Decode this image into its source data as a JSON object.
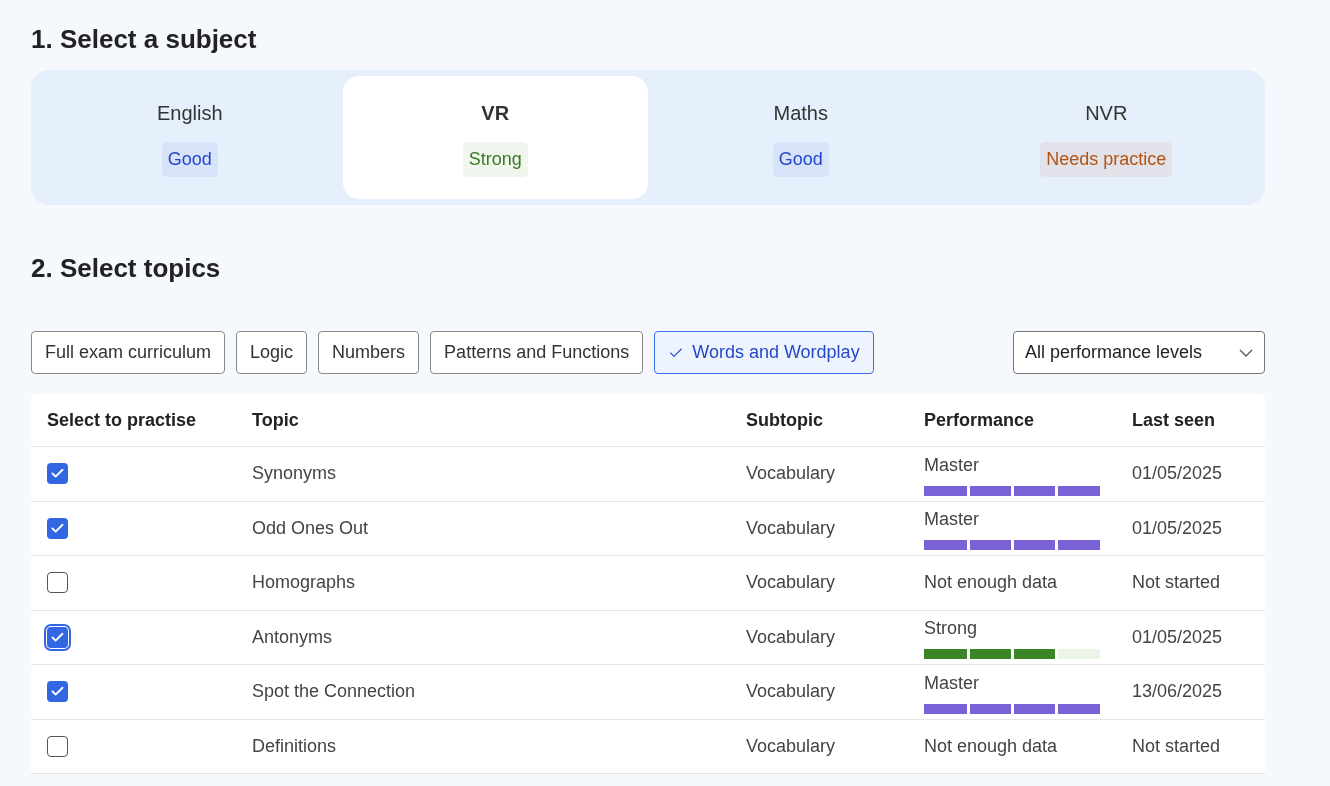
{
  "subject_section": {
    "heading": "1. Select a subject"
  },
  "subjects": [
    {
      "name": "English",
      "badge": "Good",
      "color": "#2447c9",
      "selected": false
    },
    {
      "name": "VR",
      "badge": "Strong",
      "color": "#3a7a22",
      "selected": true
    },
    {
      "name": "Maths",
      "badge": "Good",
      "color": "#2447c9",
      "selected": false
    },
    {
      "name": "NVR",
      "badge": "Needs practice",
      "color": "#b4520f",
      "selected": false
    }
  ],
  "topics_section": {
    "heading": "2. Select topics"
  },
  "filters": [
    {
      "label": "Full exam curriculum",
      "selected": false
    },
    {
      "label": "Logic",
      "selected": false
    },
    {
      "label": "Numbers",
      "selected": false
    },
    {
      "label": "Patterns and Functions",
      "selected": false
    },
    {
      "label": "Words and Wordplay",
      "selected": true
    }
  ],
  "performance_filter": {
    "value": "All performance levels"
  },
  "table": {
    "columns": [
      "Select to practise",
      "Topic",
      "Subtopic",
      "Performance",
      "Last seen"
    ],
    "rows": [
      {
        "checked": true,
        "focused": false,
        "topic": "Synonyms",
        "subtopic": "Vocabulary",
        "performance": {
          "kind": "bars",
          "label": "Master",
          "level": 1,
          "color": "#7b61d6"
        },
        "last_seen": "01/05/2025"
      },
      {
        "checked": true,
        "focused": false,
        "topic": "Odd Ones Out",
        "subtopic": "Vocabulary",
        "performance": {
          "kind": "bars",
          "label": "Master",
          "level": 1,
          "color": "#7b61d6"
        },
        "last_seen": "01/05/2025"
      },
      {
        "checked": false,
        "focused": false,
        "topic": "Homographs",
        "subtopic": "Vocabulary",
        "performance": {
          "kind": "text",
          "label": "Not enough data"
        },
        "last_seen": "Not started"
      },
      {
        "checked": true,
        "focused": true,
        "topic": "Antonyms",
        "subtopic": "Vocabulary",
        "performance": {
          "kind": "bars",
          "label": "Strong",
          "level": 0.75,
          "color": "#3a8526"
        },
        "last_seen": "01/05/2025"
      },
      {
        "checked": true,
        "focused": false,
        "topic": "Spot the Connection",
        "subtopic": "Vocabulary",
        "performance": {
          "kind": "bars",
          "label": "Master",
          "level": 1,
          "color": "#7b61d6"
        },
        "last_seen": "13/06/2025"
      },
      {
        "checked": false,
        "focused": false,
        "topic": "Definitions",
        "subtopic": "Vocabulary",
        "performance": {
          "kind": "text",
          "label": "Not enough data"
        },
        "last_seen": "Not started"
      }
    ]
  }
}
